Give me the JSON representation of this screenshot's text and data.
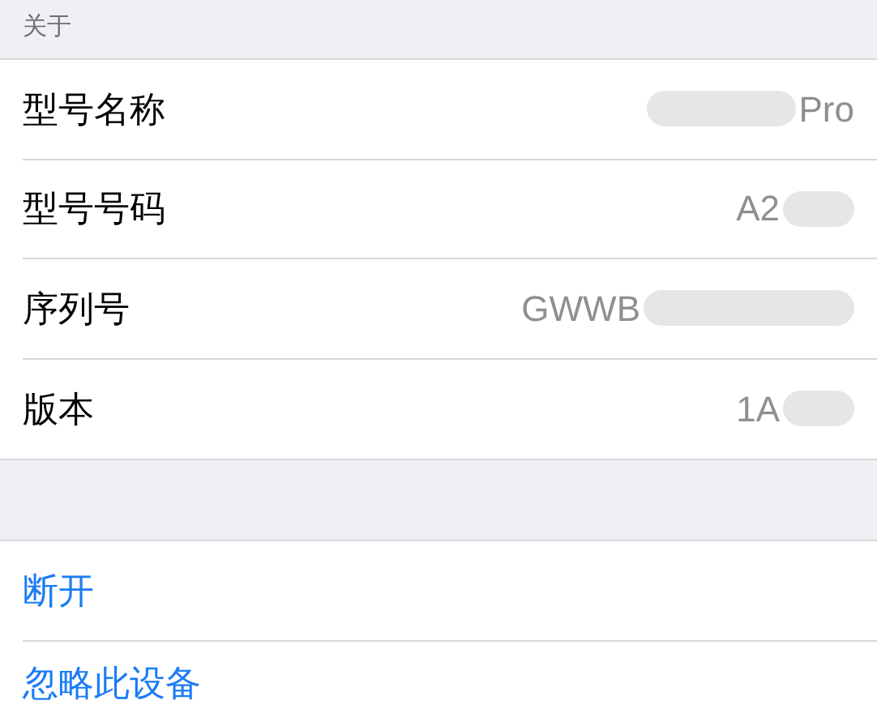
{
  "section_header": "关于",
  "rows": [
    {
      "label": "型号名称",
      "value": "Pro",
      "kind": "redacted_before"
    },
    {
      "label": "型号号码",
      "value": "A2",
      "kind": "redacted_after"
    },
    {
      "label": "序列号",
      "value": "GWWB",
      "kind": "redacted_after"
    },
    {
      "label": "版本",
      "value": "1A",
      "kind": "redacted_after"
    }
  ],
  "actions": [
    "断开",
    "忽略此设备"
  ]
}
